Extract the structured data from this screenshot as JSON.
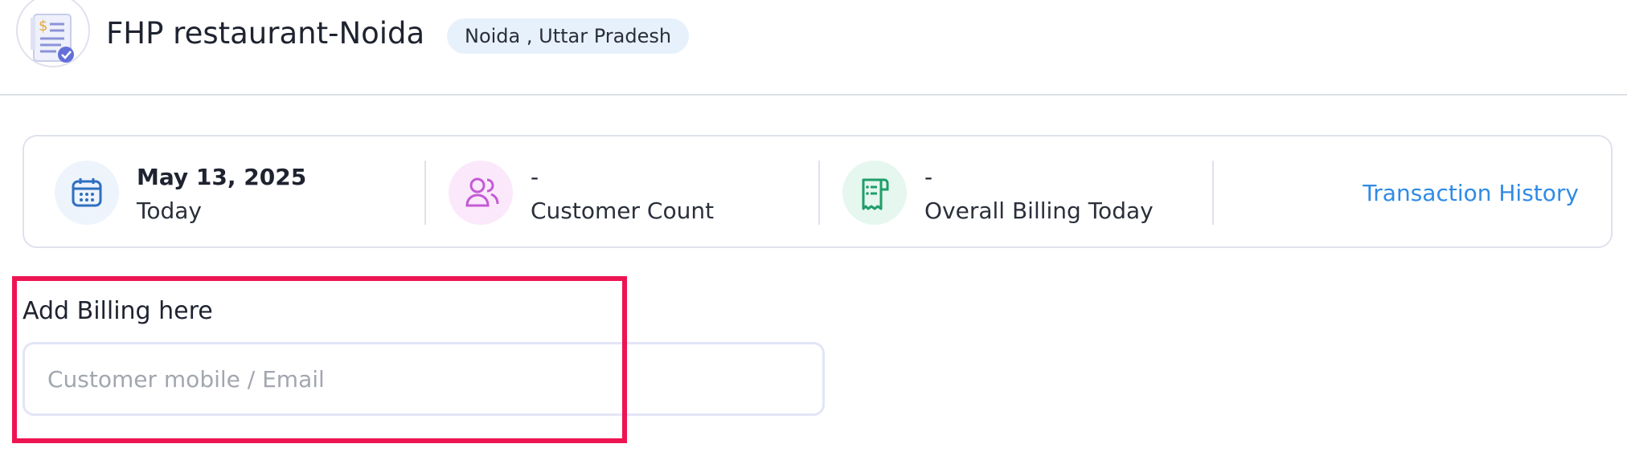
{
  "header": {
    "title": "FHP restaurant-Noida",
    "location": "Noida , Uttar Pradesh",
    "logo_icon": "receipt-check-icon"
  },
  "stats": {
    "date": {
      "value": "May 13, 2025",
      "label": "Today",
      "icon": "calendar-icon",
      "icon_bg": "#edf4fc",
      "icon_color": "#2f6fbf"
    },
    "customers": {
      "value": "-",
      "label": "Customer Count",
      "icon": "users-icon",
      "icon_bg": "#fbe9fb",
      "icon_color": "#c45ad6"
    },
    "billing": {
      "value": "-",
      "label": "Overall Billing Today",
      "icon": "receipt-icon",
      "icon_bg": "#e5f7ef",
      "icon_color": "#1f9e6a"
    },
    "transaction_history": "Transaction History"
  },
  "billing_form": {
    "title": "Add Billing here",
    "placeholder": "Customer mobile / Email",
    "value": ""
  },
  "colors": {
    "link": "#2f8be6",
    "highlight": "#ee1452",
    "badge_bg": "#e7f1fb"
  }
}
